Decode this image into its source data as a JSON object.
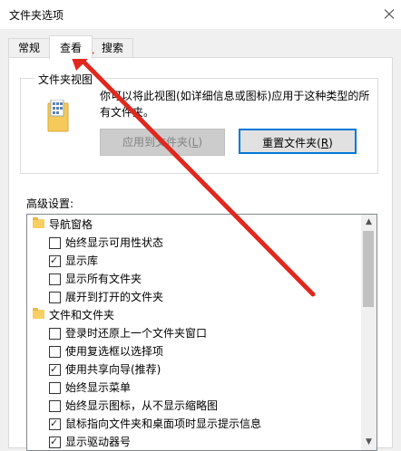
{
  "window": {
    "title": "文件夹选项"
  },
  "tabs": [
    {
      "label": "常规"
    },
    {
      "label": "查看"
    },
    {
      "label": "搜索"
    }
  ],
  "folder_view": {
    "group_title": "文件夹视图",
    "description": "你可以将此视图(如详细信息或图标)应用于这种类型的所有文件夹。",
    "apply_button": {
      "text": "应用到文件夹(",
      "key": "L",
      "suffix": ")"
    },
    "reset_button": {
      "text": "重置文件夹(",
      "key": "R",
      "suffix": ")"
    }
  },
  "advanced": {
    "label": "高级设置:",
    "items": [
      {
        "label": "导航窗格",
        "type": "folder",
        "checked": false
      },
      {
        "label": "始终显示可用性状态",
        "type": "checkbox",
        "checked": false
      },
      {
        "label": "显示库",
        "type": "checkbox",
        "checked": true
      },
      {
        "label": "显示所有文件夹",
        "type": "checkbox",
        "checked": false
      },
      {
        "label": "展开到打开的文件夹",
        "type": "checkbox",
        "checked": false
      },
      {
        "label": "文件和文件夹",
        "type": "folder",
        "checked": false
      },
      {
        "label": "登录时还原上一个文件夹窗口",
        "type": "checkbox",
        "checked": false
      },
      {
        "label": "使用复选框以选择项",
        "type": "checkbox",
        "checked": false
      },
      {
        "label": "使用共享向导(推荐)",
        "type": "checkbox",
        "checked": true
      },
      {
        "label": "始终显示菜单",
        "type": "checkbox",
        "checked": false
      },
      {
        "label": "始终显示图标，从不显示缩略图",
        "type": "checkbox",
        "checked": false
      },
      {
        "label": "鼠标指向文件夹和桌面项时显示提示信息",
        "type": "checkbox",
        "checked": true
      },
      {
        "label": "显示驱动器号",
        "type": "checkbox",
        "checked": true
      }
    ]
  },
  "colors": {
    "accent": "#0078d7",
    "annotation_arrow": "#e0281e"
  }
}
